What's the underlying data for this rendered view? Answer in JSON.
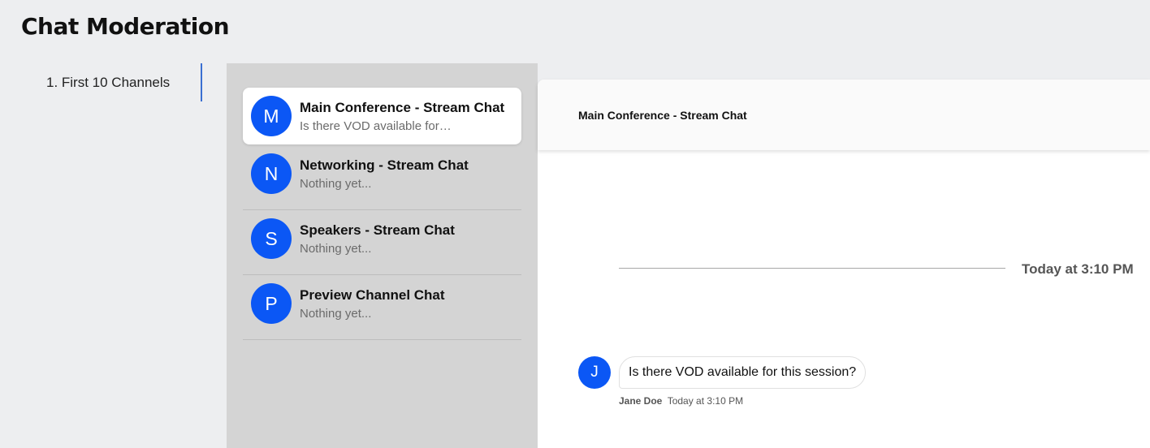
{
  "page": {
    "title": "Chat Moderation"
  },
  "nav": {
    "items": [
      {
        "label": "1. First 10 Channels"
      }
    ]
  },
  "channels": [
    {
      "initial": "M",
      "name": "Main Conference - Stream Chat",
      "preview": "Is there VOD available for…",
      "active": true
    },
    {
      "initial": "N",
      "name": "Networking - Stream Chat",
      "preview": "Nothing yet...",
      "active": false
    },
    {
      "initial": "S",
      "name": "Speakers - Stream Chat",
      "preview": "Nothing yet...",
      "active": false
    },
    {
      "initial": "P",
      "name": "Preview Channel Chat",
      "preview": "Nothing yet...",
      "active": false
    }
  ],
  "chat": {
    "header_title": "Main Conference - Stream Chat",
    "date_divider": "Today at 3:10 PM",
    "messages": [
      {
        "avatar_initial": "J",
        "text": "Is there VOD available for this session?",
        "author": "Jane Doe",
        "time": "Today at 3:10 PM"
      }
    ]
  },
  "colors": {
    "accent": "#0b57f5",
    "nav_indicator": "#3a6fd1",
    "channel_panel_bg": "#d4d4d4",
    "page_bg": "#edeef0"
  },
  "icons": {
    "channel_avatar": "letter-avatar-circle",
    "message_avatar": "letter-avatar-circle"
  }
}
